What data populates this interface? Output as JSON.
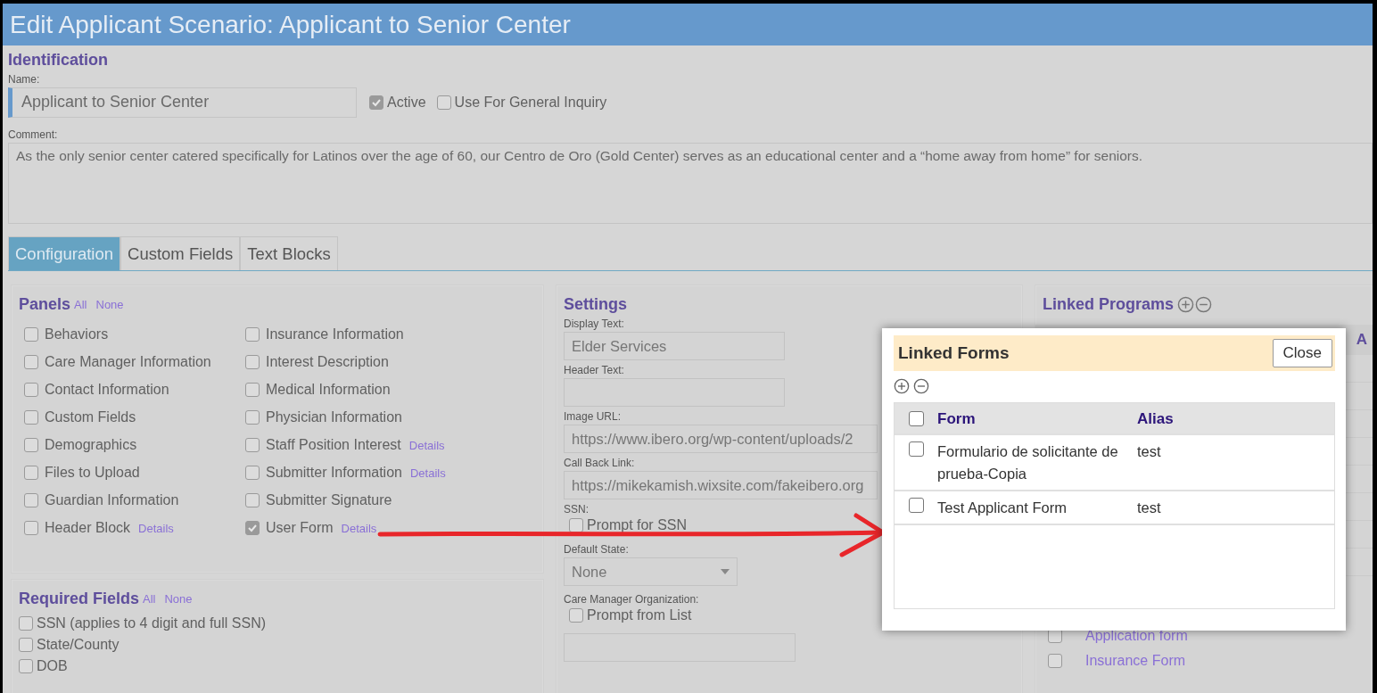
{
  "title": "Edit Applicant Scenario: Applicant to Senior Center",
  "identification": {
    "heading": "Identification",
    "name_label": "Name:",
    "name_value": "Applicant to Senior Center",
    "options": [
      {
        "label": "Active",
        "checked": true
      },
      {
        "label": "Use For General Inquiry",
        "checked": false
      }
    ],
    "comment_label": "Comment:",
    "comment_value": "As the only senior center catered specifically for Latinos over the age of 60, our Centro de Oro (Gold Center) serves as an educational center and a “home away from home” for seniors."
  },
  "tabs": [
    {
      "label": "Configuration",
      "selected": true
    },
    {
      "label": "Custom Fields",
      "selected": false
    },
    {
      "label": "Text Blocks",
      "selected": false
    }
  ],
  "panels": {
    "heading": "Panels",
    "all": "All",
    "none": "None",
    "columns": [
      [
        {
          "label": "Behaviors",
          "checked": false
        },
        {
          "label": "Care Manager Information",
          "checked": false
        },
        {
          "label": "Contact Information",
          "checked": false
        },
        {
          "label": "Custom Fields",
          "checked": false
        },
        {
          "label": "Demographics",
          "checked": false
        },
        {
          "label": "Files to Upload",
          "checked": false
        },
        {
          "label": "Guardian Information",
          "checked": false
        },
        {
          "label": "Header Block",
          "checked": false,
          "details": "Details"
        }
      ],
      [
        {
          "label": "Insurance Information",
          "checked": false
        },
        {
          "label": "Interest Description",
          "checked": false
        },
        {
          "label": "Medical Information",
          "checked": false
        },
        {
          "label": "Physician Information",
          "checked": false
        },
        {
          "label": "Staff Position Interest",
          "checked": false,
          "details": "Details"
        },
        {
          "label": "Submitter Information",
          "checked": false,
          "details": "Details"
        },
        {
          "label": "Submitter Signature",
          "checked": false
        },
        {
          "label": "User Form",
          "checked": true,
          "details": "Details"
        }
      ]
    ]
  },
  "required_fields": {
    "heading": "Required Fields",
    "all": "All",
    "none": "None",
    "items": [
      {
        "label": "SSN (applies to 4 digit and full SSN)",
        "checked": false
      },
      {
        "label": "State/County",
        "checked": false
      },
      {
        "label": "DOB",
        "checked": false
      }
    ]
  },
  "settings": {
    "heading": "Settings",
    "fields": [
      {
        "kind": "text",
        "label": "Display Text:",
        "value": "Elder Services"
      },
      {
        "kind": "text",
        "label": "Header Text:"
      },
      {
        "kind": "url",
        "label": "Image URL:",
        "value": "https://www.ibero.org/wp-content/uploads/2"
      },
      {
        "kind": "url",
        "label": "Call Back Link:",
        "value": "https://mikekamish.wixsite.com/fakeibero.org"
      },
      {
        "kind": "checkbox",
        "label": "SSN:",
        "option": "Prompt for SSN",
        "checked": false
      },
      {
        "kind": "select",
        "label": "Default State:",
        "value": "None"
      },
      {
        "kind": "checkbox_select",
        "label": "Care Manager Organization:",
        "option": "Prompt from List",
        "checked": false
      }
    ]
  },
  "linked_programs": {
    "heading": "Linked Programs",
    "column_2": "A",
    "items": [
      {
        "label": "Application form",
        "checked": false
      },
      {
        "label": "Insurance Form",
        "checked": false
      }
    ]
  },
  "modal": {
    "title": "Linked Forms",
    "close": "Close",
    "columns": [
      "Form",
      "Alias"
    ],
    "header_checked": false,
    "rows": [
      {
        "form": "Formulario de solicitante de prueba-Copia",
        "alias": "test",
        "checked": false
      },
      {
        "form": "Test Applicant Form",
        "alias": "test",
        "checked": false
      }
    ]
  }
}
